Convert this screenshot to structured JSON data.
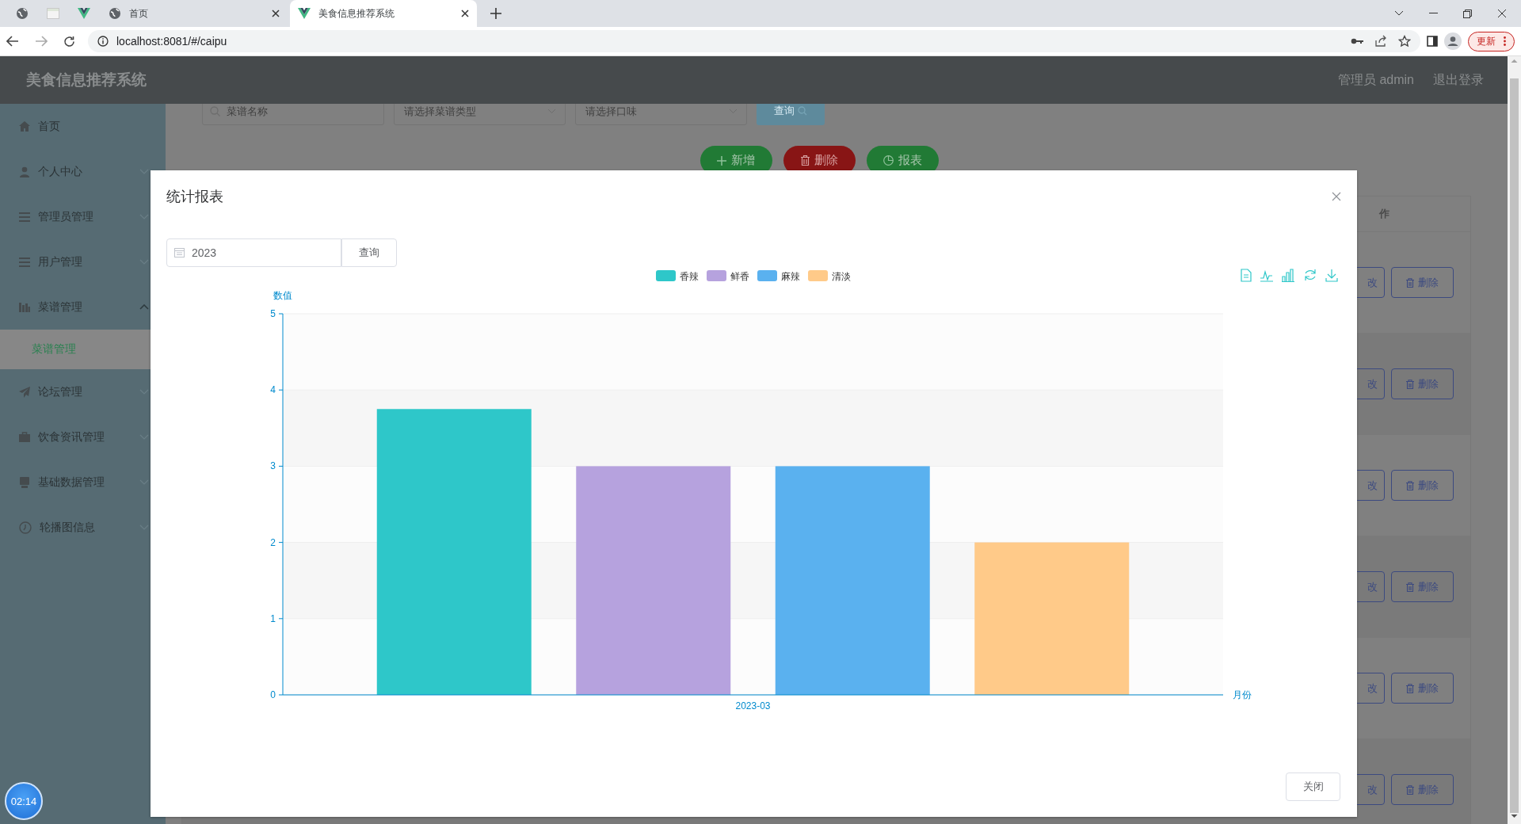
{
  "browser": {
    "tabs": [
      {
        "kind": "globe",
        "selected": false
      },
      {
        "kind": "page",
        "selected": false
      },
      {
        "kind": "vue",
        "selected": false
      },
      {
        "kind": "globe",
        "title": "首页",
        "selected": false
      },
      {
        "kind": "vue",
        "title": "美食信息推荐系统",
        "selected": true
      }
    ],
    "url": "localhost:8081/#/caipu",
    "update_button": "更新"
  },
  "app": {
    "title": "美食信息推荐系统",
    "user": "管理员 admin",
    "logout": "退出登录"
  },
  "sidebar": {
    "items": [
      {
        "kind": "home",
        "label": "首页"
      },
      {
        "kind": "user",
        "label": "个人中心",
        "expanded": false
      },
      {
        "kind": "list",
        "label": "管理员管理",
        "expanded": false
      },
      {
        "kind": "list",
        "label": "用户管理",
        "expanded": false
      },
      {
        "kind": "chart",
        "label": "菜谱管理",
        "expanded": true,
        "children": [
          {
            "label": "菜谱管理",
            "selected": true
          }
        ]
      },
      {
        "kind": "plane",
        "label": "论坛管理",
        "expanded": false
      },
      {
        "kind": "bag",
        "label": "饮食资讯管理",
        "expanded": false
      },
      {
        "kind": "monitor",
        "label": "基础数据管理",
        "expanded": false
      },
      {
        "kind": "clock",
        "label": "轮播图信息",
        "expanded": false
      }
    ]
  },
  "filters": [
    {
      "kind": "search",
      "placeholder": "菜谱名称"
    },
    {
      "kind": "select",
      "placeholder": "请选择菜谱类型"
    },
    {
      "kind": "select",
      "placeholder": "请选择口味"
    }
  ],
  "search_button": "查询",
  "actions": [
    {
      "kind": "add",
      "label": "新增"
    },
    {
      "kind": "delete",
      "label": "删除"
    },
    {
      "kind": "report",
      "label": "报表"
    }
  ],
  "table": {
    "columns": [
      "作"
    ],
    "rows": [
      {
        "edit": "改",
        "delete": "删除"
      },
      {
        "edit": "改",
        "delete": "删除"
      },
      {
        "edit": "改",
        "delete": "删除"
      },
      {
        "edit": "改",
        "delete": "删除"
      },
      {
        "edit": "改",
        "delete": "删除"
      },
      {
        "edit": "改",
        "delete": "删除"
      }
    ]
  },
  "dialog": {
    "title": "统计报表",
    "year": "2023",
    "query_button": "查询",
    "close_button": "关闭",
    "chart_data": {
      "type": "bar",
      "xlabel": "月份",
      "ylabel": "数值",
      "categories": [
        "2023-03"
      ],
      "series": [
        {
          "name": "香辣",
          "color": "#2ec7c9",
          "values": [
            3.75
          ]
        },
        {
          "name": "鲜香",
          "color": "#b6a2de",
          "values": [
            3
          ]
        },
        {
          "name": "麻辣",
          "color": "#5ab1ef",
          "values": [
            3
          ]
        },
        {
          "name": "清淡",
          "color": "#ffca89",
          "values": [
            2
          ]
        }
      ],
      "ylim": [
        0,
        5
      ],
      "yticks": [
        0,
        1,
        2,
        3,
        4,
        5
      ],
      "grid": true,
      "legend": true
    }
  },
  "timer": "02:14"
}
